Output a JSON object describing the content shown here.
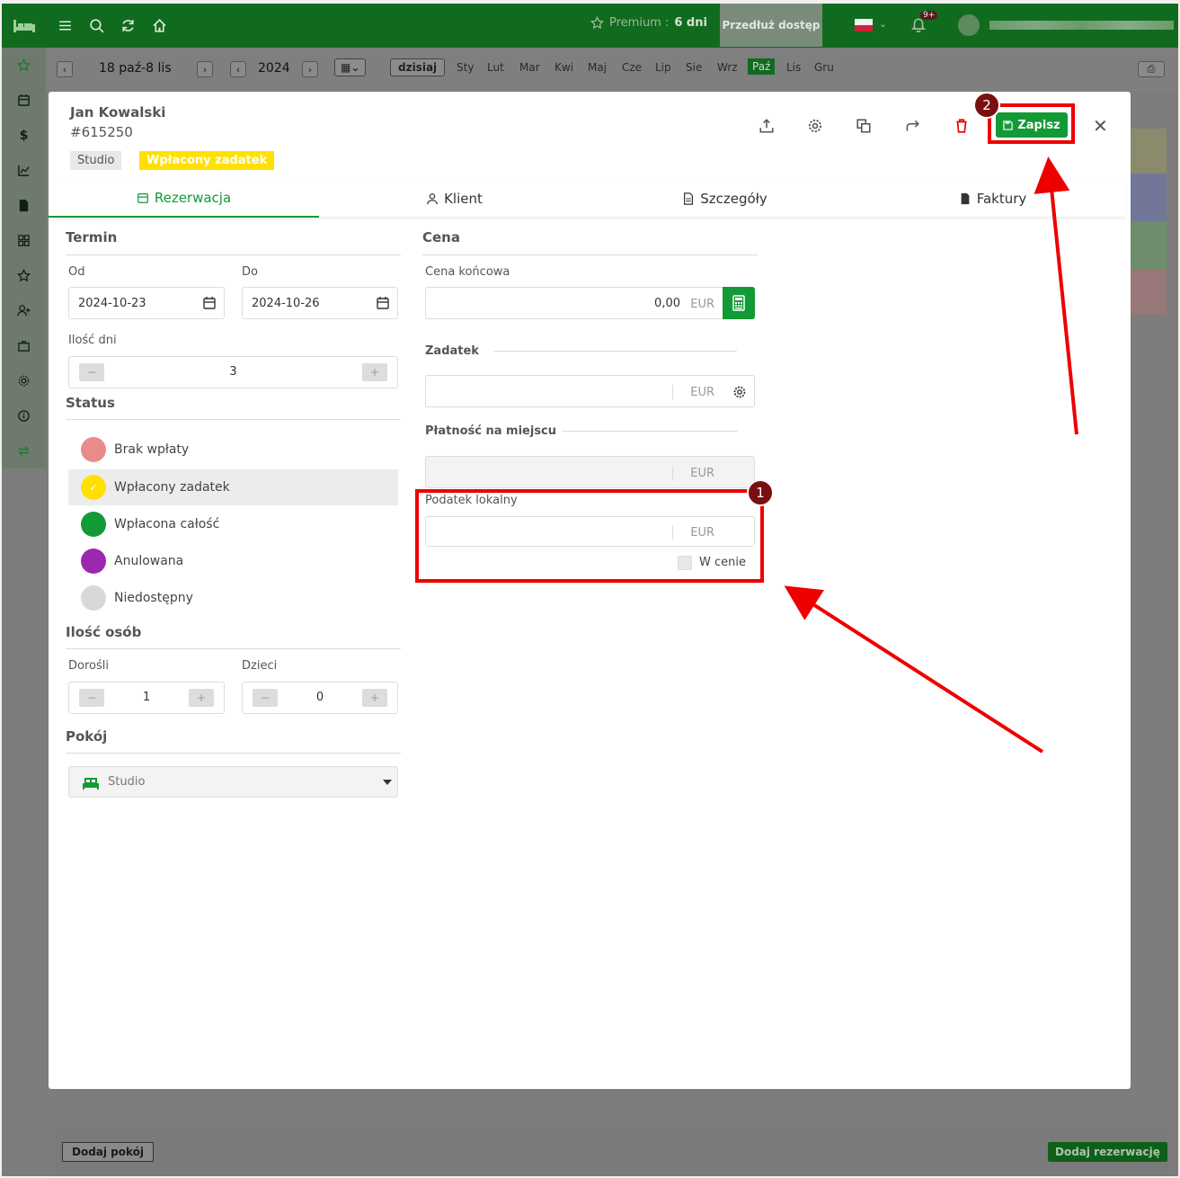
{
  "topbar": {
    "premium_label": "Premium :",
    "premium_days": "6 dni",
    "extend_button": "Przedłuż dostęp",
    "notification_count": "9+"
  },
  "calendar_nav": {
    "range": "18 paź-8 lis",
    "year": "2024",
    "today_button": "dzisiaj",
    "months": [
      "Sty",
      "Lut",
      "Mar",
      "Kwi",
      "Maj",
      "Cze",
      "Lip",
      "Sie",
      "Wrz",
      "Paź",
      "Lis",
      "Gru"
    ],
    "active_month": "Paź"
  },
  "footer": {
    "add_room_button": "Dodaj pokój",
    "add_reservation_button": "Dodaj rezerwację"
  },
  "modal": {
    "guest_name": "Jan Kowalski",
    "reservation_number": "#615250",
    "room_tag": "Studio",
    "status_tag": "Wpłacony zadatek",
    "save_button": "Zapisz",
    "tabs": {
      "reservation": "Rezerwacja",
      "client": "Klient",
      "details": "Szczegóły",
      "invoices": "Faktury"
    },
    "term": {
      "title": "Termin",
      "from_label": "Od",
      "from_value": "2024-10-23",
      "to_label": "Do",
      "to_value": "2024-10-26",
      "days_label": "Ilość dni",
      "days_value": "3"
    },
    "status": {
      "title": "Status",
      "options": [
        {
          "label": "Brak wpłaty",
          "color": "#e98b8b"
        },
        {
          "label": "Wpłacony zadatek",
          "color": "#ffe000"
        },
        {
          "label": "Wpłacona całość",
          "color": "#129a36"
        },
        {
          "label": "Anulowana",
          "color": "#9c27b0"
        },
        {
          "label": "Niedostępny",
          "color": "#d8d8d8"
        }
      ],
      "selected": "Wpłacony zadatek"
    },
    "persons": {
      "title": "Ilość osób",
      "adults_label": "Dorośli",
      "adults_value": "1",
      "children_label": "Dzieci",
      "children_value": "0"
    },
    "room": {
      "title": "Pokój",
      "selected": "Studio"
    },
    "price": {
      "title": "Cena",
      "final_price_label": "Cena końcowa",
      "final_price_value": "0,00",
      "currency": "EUR",
      "deposit_label": "Zadatek",
      "onsite_label": "Płatność na miejscu",
      "local_tax_label": "Podatek lokalny",
      "in_price_label": "W cenie"
    }
  },
  "annotations": {
    "badge_1": "1",
    "badge_2": "2",
    "color": "#e00000"
  }
}
